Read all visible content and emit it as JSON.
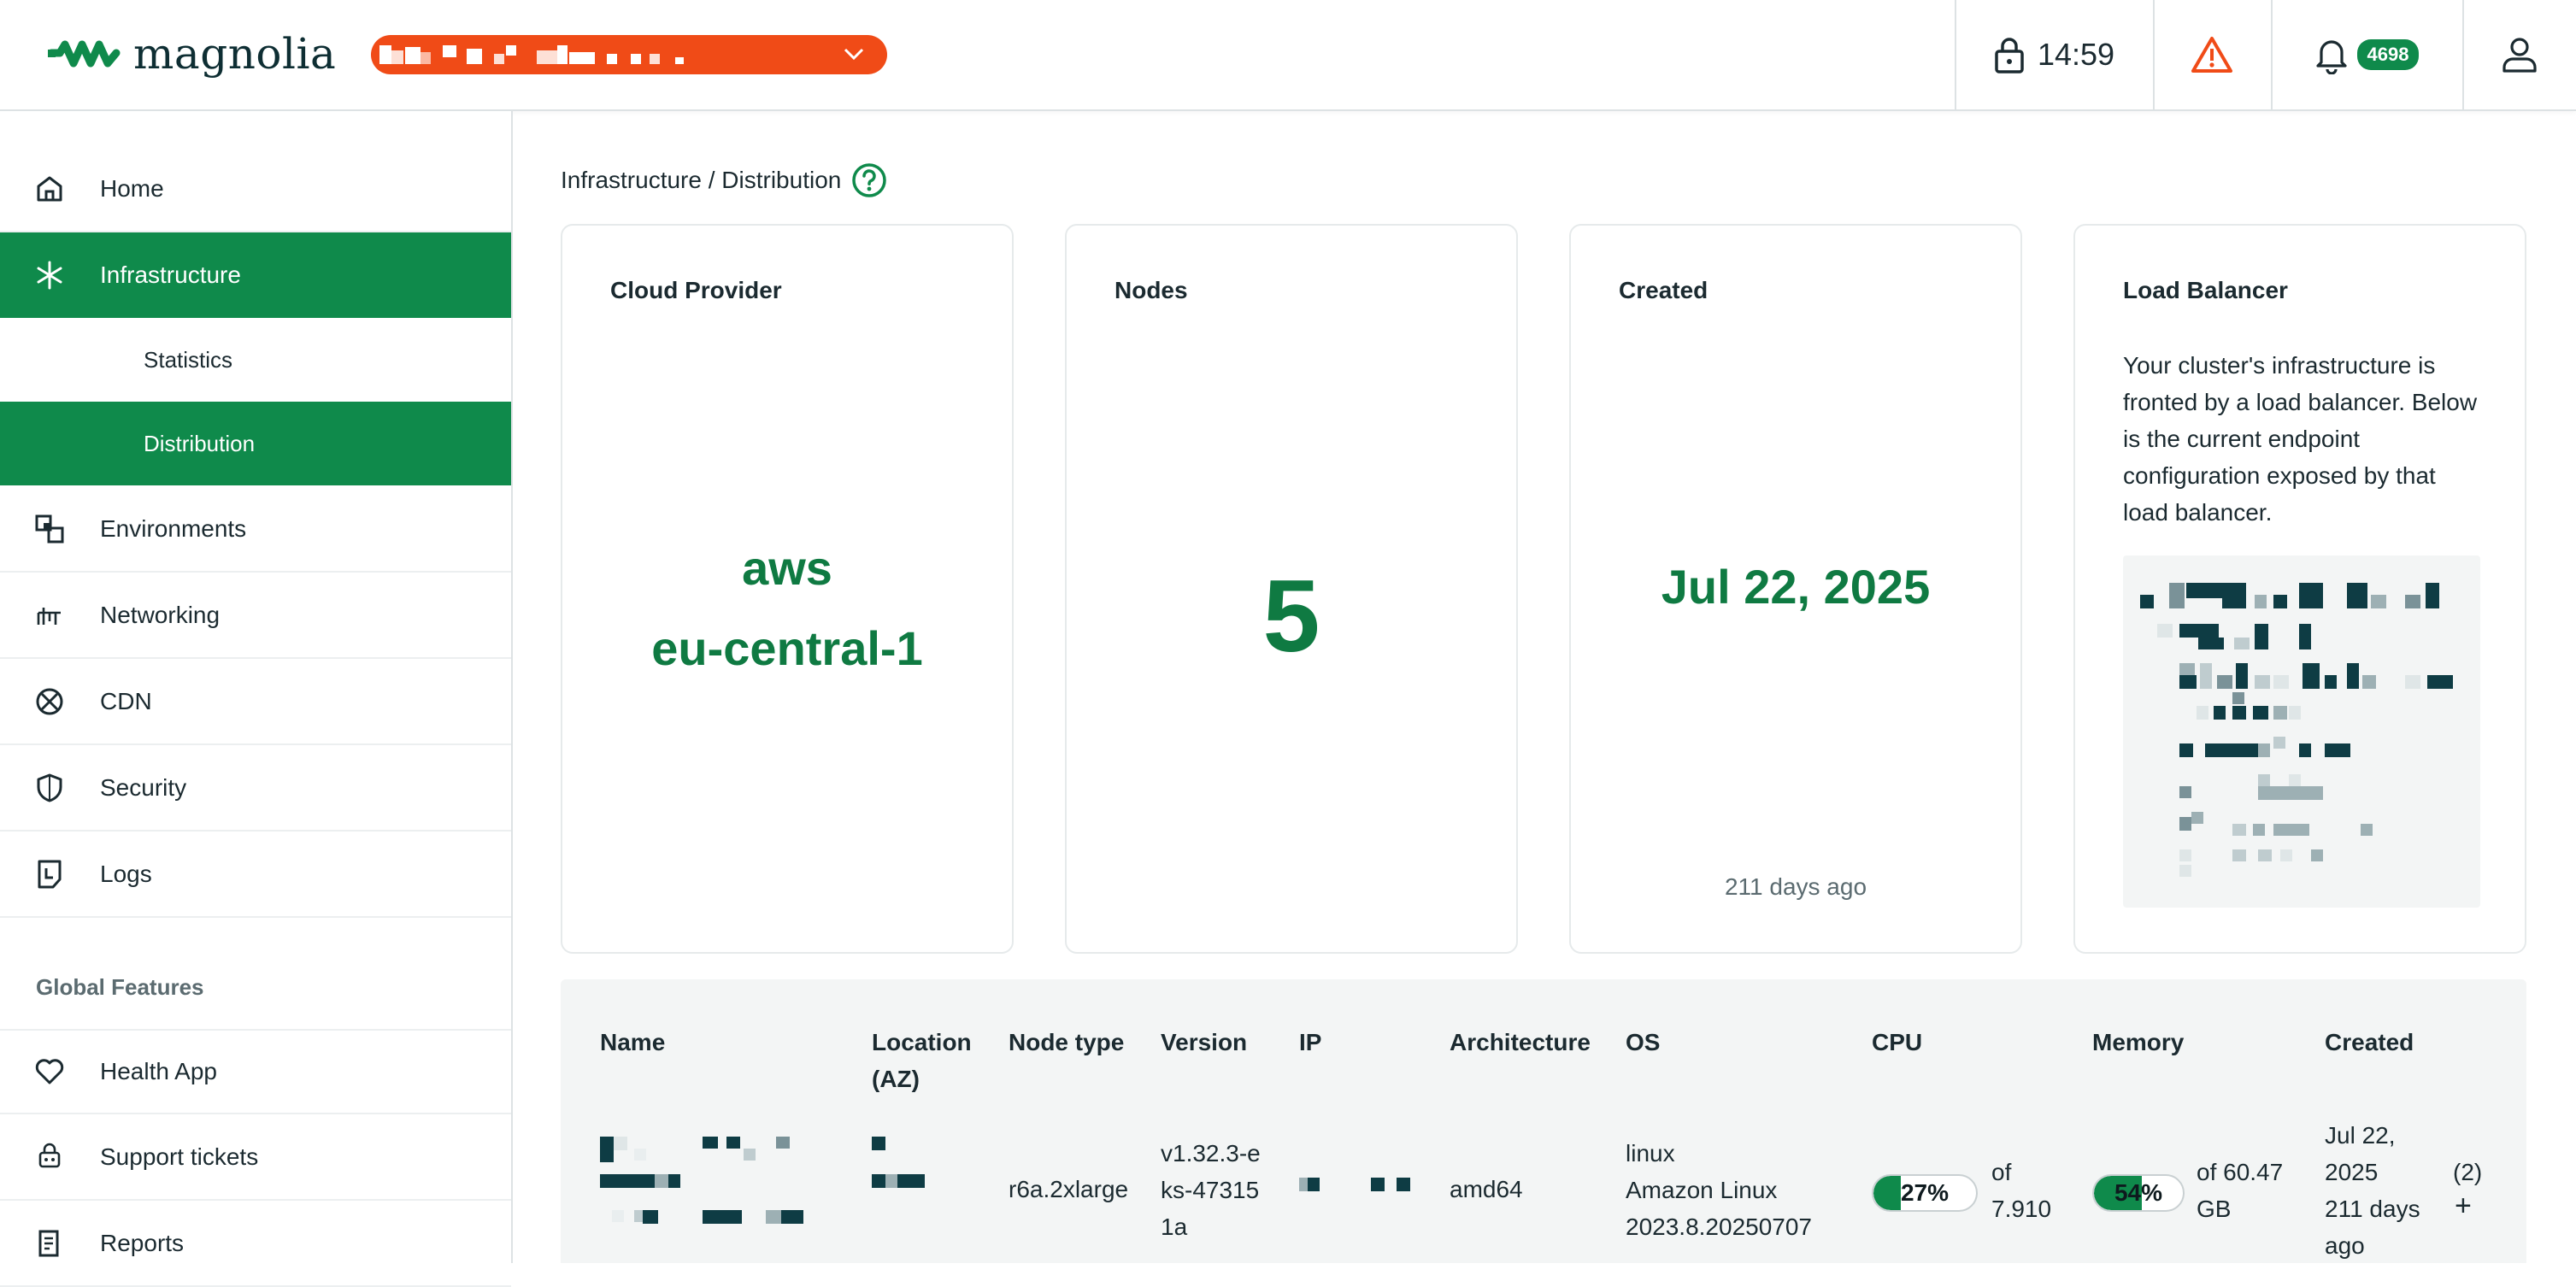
{
  "header": {
    "brand": "magnolia",
    "session_time": "14:59",
    "notification_count": "4698",
    "environment_selector": {
      "color": "#f04b17"
    }
  },
  "sidebar": {
    "items": [
      {
        "label": "Home",
        "icon": "home-icon"
      },
      {
        "label": "Infrastructure",
        "icon": "asterisk-icon",
        "active": true,
        "children": [
          {
            "label": "Statistics"
          },
          {
            "label": "Distribution",
            "active": true
          }
        ]
      },
      {
        "label": "Environments",
        "icon": "environments-icon"
      },
      {
        "label": "Networking",
        "icon": "networking-icon"
      },
      {
        "label": "CDN",
        "icon": "cdn-icon"
      },
      {
        "label": "Security",
        "icon": "shield-icon"
      },
      {
        "label": "Logs",
        "icon": "logs-icon"
      }
    ],
    "section_title": "Global Features",
    "global_items": [
      {
        "label": "Health App",
        "icon": "heart-icon"
      },
      {
        "label": "Support tickets",
        "icon": "support-icon"
      },
      {
        "label": "Reports",
        "icon": "reports-icon"
      }
    ]
  },
  "breadcrumb": "Infrastructure / Distribution",
  "cards": {
    "cloud_provider": {
      "title": "Cloud Provider",
      "value_line1": "aws",
      "value_line2": "eu-central-1"
    },
    "nodes": {
      "title": "Nodes",
      "value": "5"
    },
    "created": {
      "title": "Created",
      "value": "Jul 22, 2025",
      "sub": "211 days ago"
    },
    "load_balancer": {
      "title": "Load Balancer",
      "text": "Your cluster's infrastructure is fronted by a load balancer. Below is the current endpoint configuration exposed by that load balancer."
    }
  },
  "table": {
    "headers": {
      "name": "Name",
      "location": "Location (AZ)",
      "node_type": "Node type",
      "version": "Version",
      "ip": "IP",
      "architecture": "Architecture",
      "os": "OS",
      "cpu": "CPU",
      "memory": "Memory",
      "created": "Created"
    },
    "rows": [
      {
        "node_type": "r6a.2xlarge",
        "version": "v1.32.3-eks-473151a",
        "architecture": "amd64",
        "os_line1": "linux",
        "os_line2": "Amazon Linux",
        "os_line3": "2023.8.20250707",
        "cpu_pct_label": "27%",
        "cpu_fraction": 0.27,
        "cpu_of_1": "of",
        "cpu_of_2": "7.910",
        "mem_pct_label": "54%",
        "mem_fraction": 0.54,
        "mem_of_1": "of 60.47",
        "mem_of_2": "GB",
        "created_1": "Jul 22,",
        "created_2": "2025",
        "created_3": "211 days",
        "created_4": "ago",
        "extra_count": "(2)",
        "expand": "+"
      }
    ]
  },
  "colors": {
    "brand_green": "#0f8a4b",
    "accent_orange": "#f04b17",
    "text_dark": "#1b2a30"
  }
}
